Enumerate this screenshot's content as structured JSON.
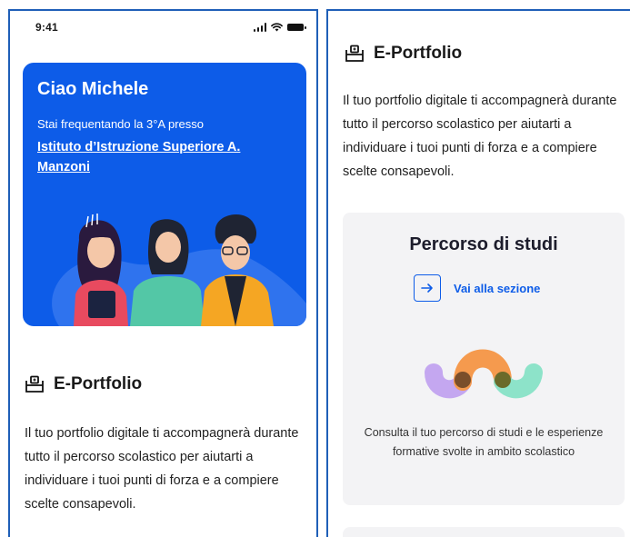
{
  "status_bar": {
    "time": "9:41"
  },
  "hero": {
    "greeting": "Ciao Michele",
    "subtitle": "Stai frequentando la 3°A presso",
    "school": "Istituto d’Istruzione Superiore A. Manzoni"
  },
  "portfolio": {
    "icon": "portfolio-icon",
    "title": "E-Portfolio",
    "description": "Il tuo portfolio digitale ti accompagnerà durante tutto il percorso scolastico per aiutarti a individuare i tuoi punti di forza e a compiere scelte consapevoli."
  },
  "card": {
    "title": "Percorso di studi",
    "link_label": "Vai alla sezione",
    "link_icon": "arrow-right-icon",
    "description": "Consulta il tuo percorso di studi e le esperienze formative svolte in ambito scolastico"
  },
  "colors": {
    "primary": "#0d5ce8",
    "card_bg": "#f3f3f5",
    "logo_purple": "#c4a7f0",
    "logo_orange": "#f59a4e",
    "logo_mint": "#8de3c9",
    "logo_overlap": "#7a4e2a"
  }
}
